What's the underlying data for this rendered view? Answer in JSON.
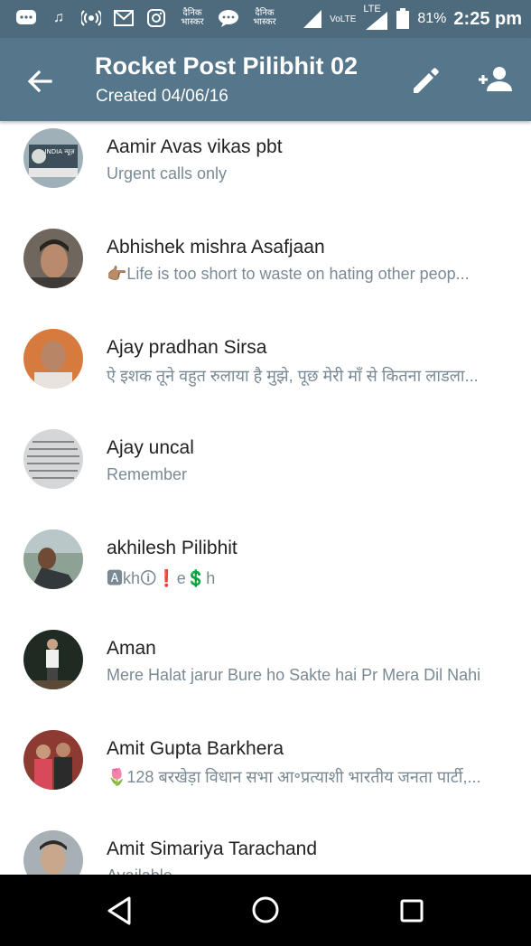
{
  "statusbar": {
    "hindi_1": "दैनिक भास्कर",
    "hindi_2": "दैनिक भास्कर",
    "volte": "VoLTE",
    "lte": "LTE",
    "battery": "81%",
    "time": "2:25 pm"
  },
  "appbar": {
    "title": "Rocket Post Pilibhit 02",
    "subtitle": "Created 04/06/16"
  },
  "contacts": [
    {
      "name": "Aamir Avas vikas pbt",
      "status": "Urgent calls only",
      "avatar_color": "#8a9aa3",
      "avatar_text": "INDIA न्यूज़"
    },
    {
      "name": "Abhishek mishra Asafjaan",
      "status": "👉🏽Life is too short to waste on hating other  peop...",
      "avatar_color": "#5a4a3e"
    },
    {
      "name": "Ajay pradhan Sirsa",
      "status": "ऐ इशक तूने वहुत रुलाया है मुझे, पूछ मेरी माँ से कितना लाडला...",
      "avatar_color": "#c46a3a"
    },
    {
      "name": "Ajay uncal",
      "status": "Remember",
      "avatar_color": "#cfd2d4"
    },
    {
      "name": "akhilesh Pilibhit",
      "status": "🅰kh🛈❗e💲h",
      "avatar_color": "#7d8e86"
    },
    {
      "name": "Aman",
      "status": "Mere Halat jarur Bure ho Sakte hai Pr Mera Dil Nahi",
      "avatar_color": "#2e3a30"
    },
    {
      "name": "Amit Gupta Barkhera",
      "status": "🌷128 बरखेड़ा विधान सभा आ॰प्रत्याशी भारतीय जनता पार्टी,...",
      "avatar_color": "#b0433c"
    },
    {
      "name": "Amit Simariya Tarachand",
      "status": "Available",
      "avatar_color": "#9aa4a8"
    }
  ],
  "colors": {
    "statusbar": "#4d6b7d",
    "appbar": "#56778b",
    "status_text": "#7a8a94"
  }
}
